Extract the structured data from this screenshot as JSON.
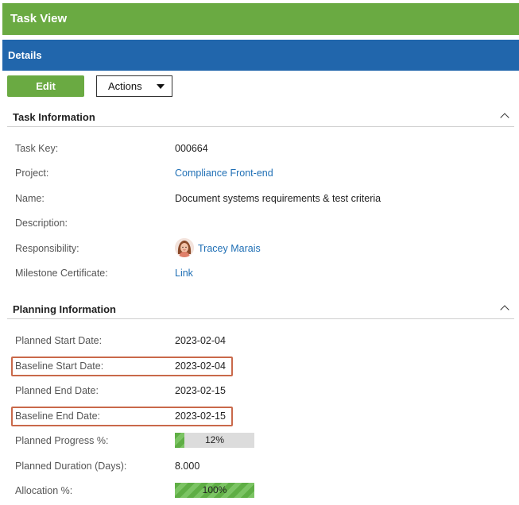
{
  "header": {
    "title": "Task View"
  },
  "details": {
    "title": "Details"
  },
  "toolbar": {
    "edit_label": "Edit",
    "actions_label": "Actions"
  },
  "task_info": {
    "title": "Task Information",
    "task_key": {
      "label": "Task Key:",
      "value": "000664"
    },
    "project": {
      "label": "Project:",
      "value": "Compliance Front-end"
    },
    "name": {
      "label": "Name:",
      "value": "Document systems requirements & test criteria"
    },
    "description": {
      "label": "Description:",
      "value": ""
    },
    "responsibility": {
      "label": "Responsibility:",
      "value": "Tracey Marais"
    },
    "milestone": {
      "label": "Milestone Certificate:",
      "value": "Link"
    }
  },
  "planning_info": {
    "title": "Planning Information",
    "planned_start": {
      "label": "Planned Start Date:",
      "value": "2023-02-04"
    },
    "baseline_start": {
      "label": "Baseline Start Date:",
      "value": "2023-02-04"
    },
    "planned_end": {
      "label": "Planned End Date:",
      "value": "2023-02-15"
    },
    "baseline_end": {
      "label": "Baseline End Date:",
      "value": "2023-02-15"
    },
    "planned_progress": {
      "label": "Planned Progress %:",
      "value": "12%",
      "percent": 12
    },
    "planned_duration": {
      "label": "Planned Duration (Days):",
      "value": "8.000"
    },
    "allocation": {
      "label": "Allocation %:",
      "value": "100%",
      "percent": 100
    }
  },
  "colors": {
    "header_green": "#6aaa42",
    "details_blue": "#2166ac",
    "link_blue": "#1f6fb5",
    "highlight_orange": "#c9694a"
  }
}
